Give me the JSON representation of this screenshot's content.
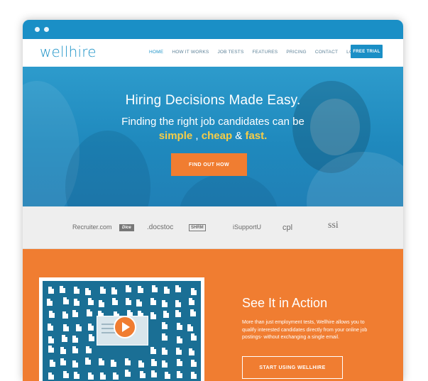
{
  "nav": {
    "logo": "wellhire",
    "items": [
      {
        "label": "HOME"
      },
      {
        "label": "HOW IT WORKS"
      },
      {
        "label": "JOB TESTS"
      },
      {
        "label": "FEATURES"
      },
      {
        "label": "PRICING"
      },
      {
        "label": "CONTACT"
      },
      {
        "label": "LOG IN"
      }
    ],
    "cta": "FREE TRIAL"
  },
  "hero": {
    "title": "Hiring Decisions Made Easy.",
    "subtitle_line1": "Finding the right job candidates can be",
    "word1": "simple",
    "sep1": " , ",
    "word2": "cheap",
    "sep2": " & ",
    "word3": "fast.",
    "button": "FIND OUT HOW"
  },
  "clients": [
    "Recruiter.com",
    "Dice",
    ".docstoc",
    "SHRM",
    "iSupportU",
    "cpl",
    "ssi"
  ],
  "action": {
    "title": "See It in Action",
    "text": "More than just employment tests, Wellhire allows you to qualify interested candidates directly from your online job postings- without exchanging a single email.",
    "button": "START USING WELLHIRE"
  },
  "colors": {
    "brand_blue": "#1a8fc6",
    "accent_orange": "#f07d31",
    "highlight_yellow": "#f7cd47"
  }
}
